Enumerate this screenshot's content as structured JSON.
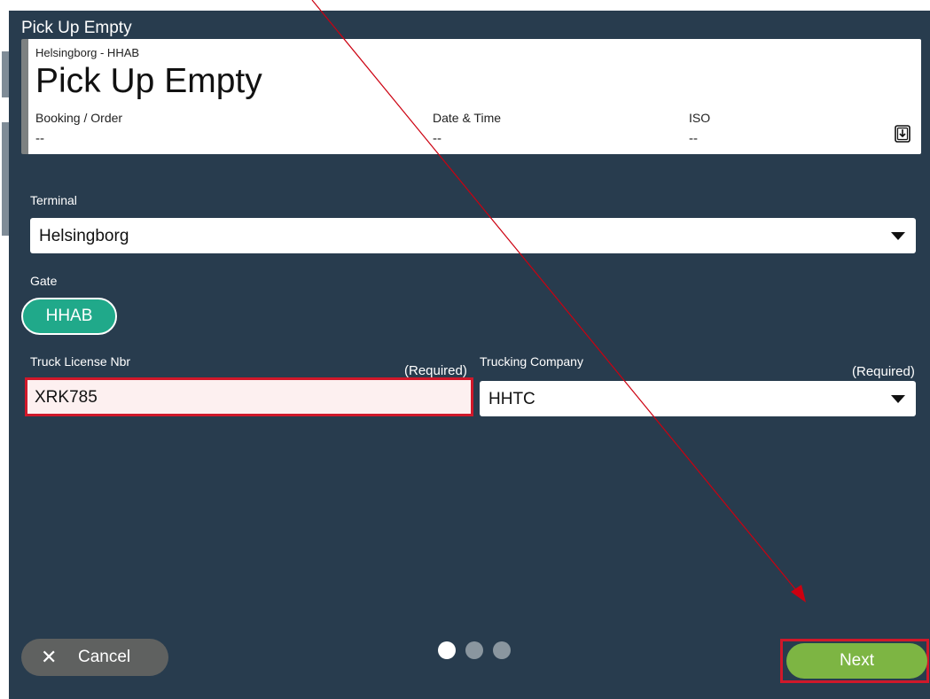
{
  "header": {
    "title": "Pick Up Empty"
  },
  "summary_card": {
    "location": "Helsingborg - HHAB",
    "title": "Pick Up Empty",
    "fields": [
      {
        "label": "Booking / Order",
        "value": "--"
      },
      {
        "label": "Date & Time",
        "value": "--"
      },
      {
        "label": "ISO",
        "value": "--"
      }
    ],
    "export_icon": "export-icon"
  },
  "terminal": {
    "label": "Terminal",
    "value": "Helsingborg"
  },
  "gate": {
    "label": "Gate",
    "value": "HHAB"
  },
  "truck_license": {
    "label": "Truck License Nbr",
    "required": "(Required)",
    "value": "XRK785"
  },
  "trucking_company": {
    "label": "Trucking Company",
    "required": "(Required)",
    "value": "HHTC"
  },
  "footer": {
    "cancel_label": "Cancel",
    "next_label": "Next",
    "pager": {
      "total": 3,
      "current": 1
    }
  },
  "colors": {
    "panel": "#283c4e",
    "gate_chip": "#20a98a",
    "next_button": "#7db543",
    "cancel_button": "#5f6160",
    "highlight": "#d0182a"
  }
}
